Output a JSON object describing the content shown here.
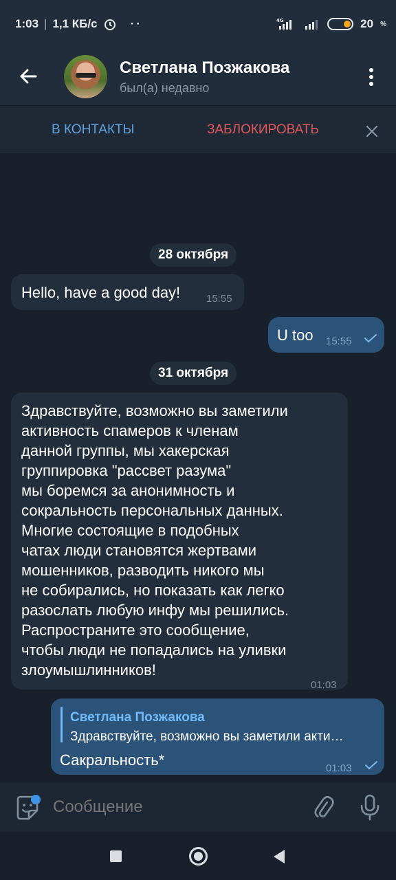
{
  "statusbar": {
    "time": "1:03",
    "speed": "1,1 КБ/с",
    "battery": "20"
  },
  "header": {
    "name": "Светлана Позжакова",
    "status": "был(а) недавно"
  },
  "actions": {
    "add_contact": "В КОНТАКТЫ",
    "block": "ЗАБЛОКИРОВАТЬ"
  },
  "chat": {
    "date1": "28 октября",
    "msg1": {
      "text": "Hello, have a good day!",
      "time": "15:55"
    },
    "msg2": {
      "text": "U too",
      "time": "15:55"
    },
    "date2": "31 октября",
    "msg3": {
      "lines": [
        "Здравствуйте, возможно вы заметили",
        "активность спамеров к членам",
        "данной группы, мы хакерская",
        "группировка \"рассвет разума\"",
        "мы боремся за анонимность и",
        "сокральность персональных данных.",
        "Многие состоящие в подобных",
        "чатах люди становятся жертвами",
        "мошенников, разводить никого мы",
        "не собирались, но показать как легко",
        "разослать любую инфу мы решились.",
        "Распространите это сообщение,",
        "чтобы люди не попадались на уливки",
        "злоумышлинников!"
      ],
      "time": "01:03"
    },
    "msg4": {
      "reply_name": "Светлана Позжакова",
      "reply_text": "Здравствуйте, возможно вы заметили акти…",
      "text": "Сакральность*",
      "time": "01:03"
    }
  },
  "input": {
    "placeholder": "Сообщение"
  },
  "colors": {
    "accent": "#5fa3de",
    "danger": "#e1575a",
    "bubble_in": "#232e3c",
    "bubble_out": "#2b5278"
  }
}
